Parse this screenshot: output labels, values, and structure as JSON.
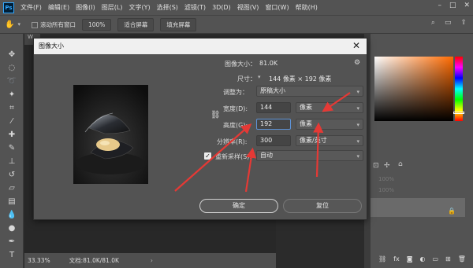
{
  "app": {
    "logo": "Ps",
    "menu": [
      "文件(F)",
      "编辑(E)",
      "图像(I)",
      "图层(L)",
      "文字(Y)",
      "选择(S)",
      "滤镜(T)",
      "3D(D)",
      "视图(V)",
      "窗口(W)",
      "帮助(H)"
    ],
    "window_controls": [
      "–",
      "□",
      "✕"
    ]
  },
  "options_bar": {
    "scroll_all": "滚动所有窗口",
    "zoom_value": "100%",
    "fit_screen": "适合屏幕",
    "fill_screen": "填充屏幕"
  },
  "document": {
    "tab": "W",
    "zoom": "33.33%",
    "doc_info": "文档:81.0K/81.0K"
  },
  "layers_panel": {
    "opacity_1": "100%",
    "opacity_2": "100%"
  },
  "dialog": {
    "title": "图像大小",
    "image_size_label": "图像大小：",
    "image_size_value": "81.0K",
    "dimensions_label": "尺寸：",
    "dimensions_value": "144 像素 × 192 像素",
    "fit_to_label": "调整为：",
    "fit_to_value": "原稿大小",
    "width_label": "宽度(D):",
    "width_value": "144",
    "width_unit": "像素",
    "height_label": "高度(G):",
    "height_value": "192",
    "height_unit": "像素",
    "resolution_label": "分辨率(R):",
    "resolution_value": "300",
    "resolution_unit": "像素/英寸",
    "resample_label": "重新采样(S):",
    "resample_value": "自动",
    "ok_button": "确定",
    "reset_button": "复位"
  },
  "colors": {
    "annotation_arrow": "#e53935",
    "focus_border": "#5d92d6"
  }
}
